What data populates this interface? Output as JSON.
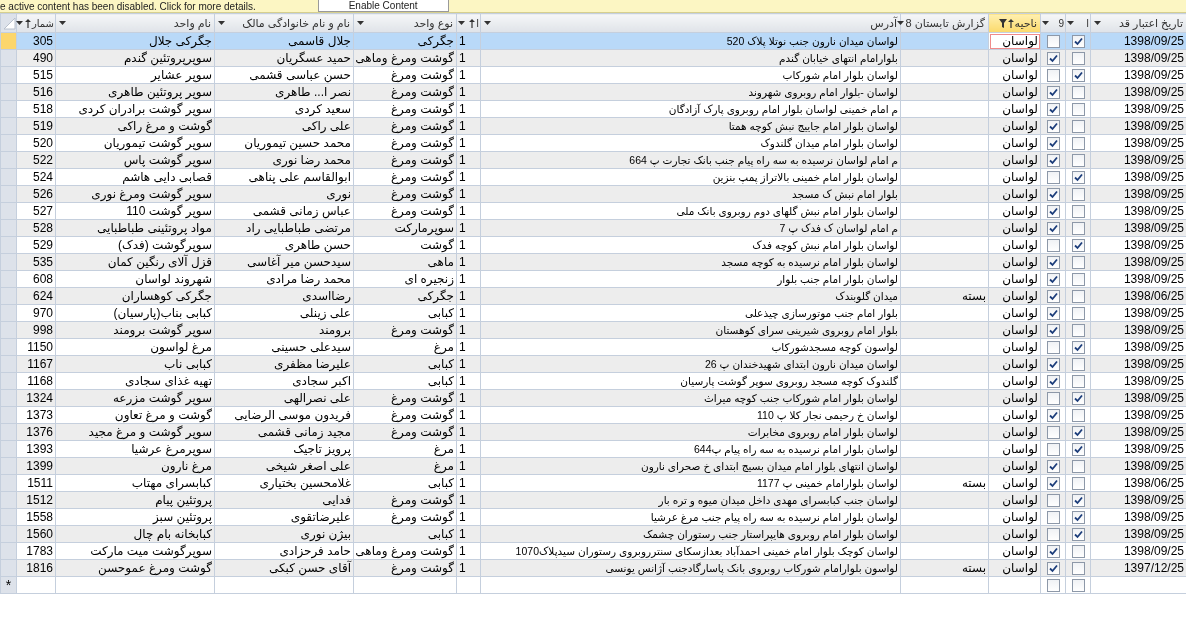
{
  "message_bar": {
    "text": "e active content has been disabled. Click for more details.",
    "button": "Enable Content"
  },
  "columns": [
    {
      "label": "تاریخ اعتبار قد",
      "kind": "text",
      "sorted": false,
      "filtered": false
    },
    {
      "label": "ا",
      "kind": "check",
      "sorted": false,
      "filtered": false
    },
    {
      "label": "9",
      "kind": "check",
      "sorted": false,
      "filtered": false
    },
    {
      "label": "ناحیه",
      "kind": "text",
      "sorted": true,
      "filtered": true
    },
    {
      "label": "گزارش تابستان 8",
      "kind": "text",
      "sorted": false,
      "filtered": false
    },
    {
      "label": "آدرس",
      "kind": "text",
      "sorted": false,
      "filtered": false
    },
    {
      "label": "ا",
      "kind": "text",
      "sorted": true,
      "filtered": false
    },
    {
      "label": "نوع  واحد",
      "kind": "text",
      "sorted": false,
      "filtered": false
    },
    {
      "label": "نام و نام خانوادگی مالک",
      "kind": "text",
      "sorted": false,
      "filtered": false
    },
    {
      "label": "نام واحد",
      "kind": "text",
      "sorted": false,
      "filtered": false
    },
    {
      "label": "شمار",
      "kind": "text",
      "sorted": true,
      "filtered": false
    }
  ],
  "rows": [
    {
      "selected": true,
      "validity_date": "1398/09/25",
      "column_2": true,
      "column_3": false,
      "region": "لواسان",
      "address": "لواسان میدان نارون جنب نوتلا پلاک 520",
      "column_7": "1",
      "unit_type": "جگرکی",
      "owner": "جلال قاسمی",
      "unit_name": "جگرکی جلال",
      "number": "305"
    },
    {
      "selected": false,
      "validity_date": "1398/09/25",
      "column_2": false,
      "column_3": true,
      "region": "لواسان",
      "address": "بلوارامام  انتهای خیابان گندم",
      "column_7": "1",
      "unit_type": "گوشت ومرغ وماهی",
      "owner": "حمید عسگریان",
      "unit_name": "سوپرپروتئین گندم",
      "number": "490"
    },
    {
      "selected": false,
      "validity_date": "1398/09/25",
      "column_2": true,
      "column_3": false,
      "region": "لواسان",
      "address": "لواسان بلوار امام شورکاب",
      "column_7": "1",
      "unit_type": "گوشت ومرغ",
      "owner": "حسن عباسی قشمی",
      "unit_name": "سوپر عشایر",
      "number": "515"
    },
    {
      "selected": false,
      "validity_date": "1398/09/25",
      "column_2": false,
      "column_3": true,
      "region": "لواسان",
      "address": "لواسان -بلوار امام روبروی شهروند",
      "column_7": "1",
      "unit_type": "گوشت ومرغ",
      "owner": "نصر ا... طاهری",
      "unit_name": "سوپر پروتئین  طاهری",
      "number": "516"
    },
    {
      "selected": false,
      "validity_date": "1398/09/25",
      "column_2": false,
      "column_3": true,
      "region": "لواسان",
      "address": "م امام خمینی لواسان بلوار امام روبروی پارک آزادگان",
      "column_7": "1",
      "unit_type": "گوشت ومرغ",
      "owner": "سعید کردی",
      "unit_name": "سوپر گوشت برادران کردی",
      "number": "518"
    },
    {
      "selected": false,
      "validity_date": "1398/09/25",
      "column_2": false,
      "column_3": true,
      "region": "لواسان",
      "address": "لواسان بلوار امام جاییج نبش کوچه همتا",
      "column_7": "1",
      "unit_type": "گوشت ومرغ",
      "owner": "علی راکی",
      "unit_name": "گوشت  و مرغ راکی",
      "number": "519"
    },
    {
      "selected": false,
      "validity_date": "1398/09/25",
      "column_2": false,
      "column_3": true,
      "region": "لواسان",
      "address": "لواسان  بلوار امام میدان  گلندوک",
      "column_7": "1",
      "unit_type": "گوشت ومرغ",
      "owner": "محمد حسین تیموریان",
      "unit_name": "سوپر گوشت تیموریان",
      "number": "520"
    },
    {
      "selected": false,
      "validity_date": "1398/09/25",
      "column_2": false,
      "column_3": true,
      "region": "لواسان",
      "address": "م امام لواسان نرسیده به سه راه پیام جنب بانک تجارت پ 664",
      "column_7": "1",
      "unit_type": "گوشت ومرغ",
      "owner": "محمد رضا نوری",
      "unit_name": "سوپر گوشت پاس",
      "number": "522"
    },
    {
      "selected": false,
      "validity_date": "1398/09/25",
      "column_2": true,
      "column_3": false,
      "region": "لواسان",
      "address": "لواسان بلوار امام خمینی بالاتراز پمپ بنزین",
      "column_7": "1",
      "unit_type": "گوشت ومرغ",
      "owner": "ابوالقاسم علی پناهی",
      "unit_name": "قصابی دایی هاشم",
      "number": "524"
    },
    {
      "selected": false,
      "validity_date": "1398/09/25",
      "column_2": false,
      "column_3": true,
      "region": "لواسان",
      "address": "بلوار امام نبش ک مسجد",
      "column_7": "1",
      "unit_type": "گوشت ومرغ",
      "owner": "نوری",
      "unit_name": "سوپر گوشت ومرغ نوری",
      "number": "526"
    },
    {
      "selected": false,
      "validity_date": "1398/09/25",
      "column_2": false,
      "column_3": true,
      "region": "لواسان",
      "address": "لواسان بلوار امام نبش گلهای دوم روبروی بانک ملی",
      "column_7": "1",
      "unit_type": "گوشت ومرغ",
      "owner": "عباس زمانی قشمی",
      "unit_name": "سوپر گوشت 110",
      "number": "527"
    },
    {
      "selected": false,
      "validity_date": "1398/09/25",
      "column_2": false,
      "column_3": true,
      "region": "لواسان",
      "address": "م امام لواسان ک فدک پ 7",
      "column_7": "1",
      "unit_type": "سوپرمارکت",
      "owner": "مرتضی طباطبایی راد",
      "unit_name": "مواد پروتئینی طباطبایی",
      "number": "528"
    },
    {
      "selected": false,
      "validity_date": "1398/09/25",
      "column_2": true,
      "column_3": false,
      "region": "لواسان",
      "address": "لواسان  بلوار امام نبش کوچه  فدک",
      "column_7": "1",
      "unit_type": "گوشت",
      "owner": "حسن طاهری",
      "unit_name": "سوپرگوشت (فدک)",
      "number": "529"
    },
    {
      "selected": false,
      "validity_date": "1398/09/25",
      "column_2": false,
      "column_3": true,
      "region": "لواسان",
      "address": "لواسان بلوار امام نرسیده به کوچه مسجد",
      "column_7": "1",
      "unit_type": "ماهی",
      "owner": "سیدحسن میر آغاسی",
      "unit_name": "قزل آلای رنگین کمان",
      "number": "535"
    },
    {
      "selected": false,
      "validity_date": "1398/09/25",
      "column_2": false,
      "column_3": true,
      "region": "لواسان",
      "address": "لواسان بلوار امام جنب بلوار",
      "column_7": "1",
      "unit_type": "زنجیره ای",
      "owner": "محمد رضا مرادی",
      "unit_name": "شهروند لواسان",
      "number": "608"
    },
    {
      "selected": false,
      "validity_date": "1398/06/25",
      "column_2": false,
      "column_3": true,
      "region": "لواسان",
      "summer_report": "بسته",
      "address": "میدان گلوبندک",
      "column_7": "1",
      "unit_type": "جگرکی",
      "owner": "رضااسدی",
      "unit_name": "جگرکی کوهساران",
      "number": "624"
    },
    {
      "selected": false,
      "validity_date": "1398/09/25",
      "column_2": false,
      "column_3": true,
      "region": "لواسان",
      "address": "بلوار امام جنب موتورسازی چیذعلی",
      "column_7": "1",
      "unit_type": "کبابی",
      "owner": "علی زینلی",
      "unit_name": "کبابی بناب(پارسیان)",
      "number": "970"
    },
    {
      "selected": false,
      "validity_date": "1398/09/25",
      "column_2": false,
      "column_3": true,
      "region": "لواسان",
      "address": "بلوار امام روبروی شیرینی سرای کوهستان",
      "column_7": "1",
      "unit_type": "گوشت ومرغ",
      "owner": "برومند",
      "unit_name": "سوپر گوشت برومند",
      "number": "998"
    },
    {
      "selected": false,
      "validity_date": "1398/09/25",
      "column_2": true,
      "column_3": false,
      "region": "لواسان",
      "address": "لواسون کوچه مسجدشورکاب",
      "column_7": "1",
      "unit_type": "مرغ",
      "owner": "سیدعلی حسینی",
      "unit_name": "مرغ لواسون",
      "number": "1150"
    },
    {
      "selected": false,
      "validity_date": "1398/09/25",
      "column_2": false,
      "column_3": true,
      "region": "لواسان",
      "address": "لواسان میدان نارون ابتدای شهیدخندان پ 26",
      "column_7": "1",
      "unit_type": "کبابی",
      "owner": "علیرضا مظفری",
      "unit_name": "کبابی ناب",
      "number": "1167"
    },
    {
      "selected": false,
      "validity_date": "1398/09/25",
      "column_2": false,
      "column_3": true,
      "region": "لواسان",
      "address": "گلندوک کوچه مسجد روبروی سوپر گوشت پارسیان",
      "column_7": "1",
      "unit_type": "کبابی",
      "owner": "اکبر سجادی",
      "unit_name": "تهیه غذای سجادی",
      "number": "1168"
    },
    {
      "selected": false,
      "validity_date": "1398/09/25",
      "column_2": true,
      "column_3": false,
      "region": "لواسان",
      "address": "لواسان بلوار امام شورکاب جنب کوچه میراث",
      "column_7": "1",
      "unit_type": "گوشت ومرغ",
      "owner": "علی نصرالهی",
      "unit_name": "سوپر گوشت مزرعه",
      "number": "1324"
    },
    {
      "selected": false,
      "validity_date": "1398/09/25",
      "column_2": false,
      "column_3": true,
      "region": "لواسان",
      "address": "لواسان خ رحیمی نجار کلا پ 110",
      "column_7": "1",
      "unit_type": "گوشت ومرغ",
      "owner": "فریدون موسی الرضایی",
      "unit_name": "گوشت و مرغ تعاون",
      "number": "1373"
    },
    {
      "selected": false,
      "validity_date": "1398/09/25",
      "column_2": true,
      "column_3": false,
      "region": "لواسان",
      "address": "لواسان بلوار امام روبروی مخابرات",
      "column_7": "1",
      "unit_type": "گوشت ومرغ",
      "owner": "مجید زمانی قشمی",
      "unit_name": "سوپر گوشت و مرغ مجید",
      "number": "1376"
    },
    {
      "selected": false,
      "validity_date": "1398/09/25",
      "column_2": true,
      "column_3": false,
      "region": "لواسان",
      "address": "لواسان بلوار امام نرسیده به سه راه پیام پ644",
      "column_7": "1",
      "unit_type": "مرغ",
      "owner": "پرویز تاجیک",
      "unit_name": "سوپرمرغ عرشیا",
      "number": "1393"
    },
    {
      "selected": false,
      "validity_date": "1398/09/25",
      "column_2": false,
      "column_3": true,
      "region": "لواسان",
      "address": "لواسان انتهای بلوار امام میدان بسیج ابتدای خ صحرای نارون",
      "column_7": "1",
      "unit_type": "مرغ",
      "owner": "علی اصغر شیخی",
      "unit_name": "مرغ نارون",
      "number": "1399"
    },
    {
      "selected": false,
      "validity_date": "1398/06/25",
      "column_2": false,
      "column_3": true,
      "region": "لواسان",
      "summer_report": "بسته",
      "address": "لواسان بلوارامام خمینی پ 1177",
      "column_7": "1",
      "unit_type": "کبابی",
      "owner": "غلامحسین بختیاری",
      "unit_name": "کبابسرای مهتاب",
      "number": "1511"
    },
    {
      "selected": false,
      "validity_date": "1398/09/25",
      "column_2": true,
      "column_3": false,
      "region": "لواسان",
      "address": "لواسان جنب کبابسرای مهدی داخل میدان میوه و تره بار",
      "column_7": "1",
      "unit_type": "گوشت ومرغ",
      "owner": "فدایی",
      "unit_name": "پروتئین پیام",
      "number": "1512"
    },
    {
      "selected": false,
      "validity_date": "1398/09/25",
      "column_2": true,
      "column_3": false,
      "region": "لواسان",
      "address": "لواسان بلوار امام نرسیده به سه راه  پیام جنب مرغ عرشیا",
      "column_7": "1",
      "unit_type": "گوشت ومرغ",
      "owner": "علیرضاتقوی",
      "unit_name": "پروتئین سبز",
      "number": "1558"
    },
    {
      "selected": false,
      "validity_date": "1398/09/25",
      "column_2": true,
      "column_3": false,
      "region": "لواسان",
      "address": "لواسان بلوار امام روبروی هایپراستار جنب رستوران چشمک",
      "column_7": "1",
      "unit_type": "کبابی",
      "owner": "بیژن نوری",
      "unit_name": "کبابخانه بام چال",
      "number": "1560"
    },
    {
      "selected": false,
      "validity_date": "1398/09/25",
      "column_2": false,
      "column_3": true,
      "region": "لواسان",
      "address": "لواسان کوچک بلوار امام خمینی احمدآباد بعدازسکای سنترروبروی رستوران سیدپلاک1070",
      "column_7": "1",
      "unit_type": "گوشت ومرغ وماهی",
      "owner": "حامد فرحزادی",
      "unit_name": "سوپرگوشت میت مارکت",
      "number": "1783"
    },
    {
      "selected": false,
      "validity_date": "1397/12/25",
      "column_2": false,
      "column_3": true,
      "region": "لواسان",
      "summer_report": "بسته",
      "address": "لواسون بلوارامام شورکاب روبروی بانک پاسارگادجنب آژانس یونسی",
      "column_7": "1",
      "unit_type": "گوشت ومرغ",
      "owner": "آقای حسن کبکی",
      "unit_name": "گوشت ومرغ عموحسن",
      "number": "1816"
    }
  ],
  "new_row": {
    "marker": "*",
    "column_2": false,
    "column_3": false
  }
}
